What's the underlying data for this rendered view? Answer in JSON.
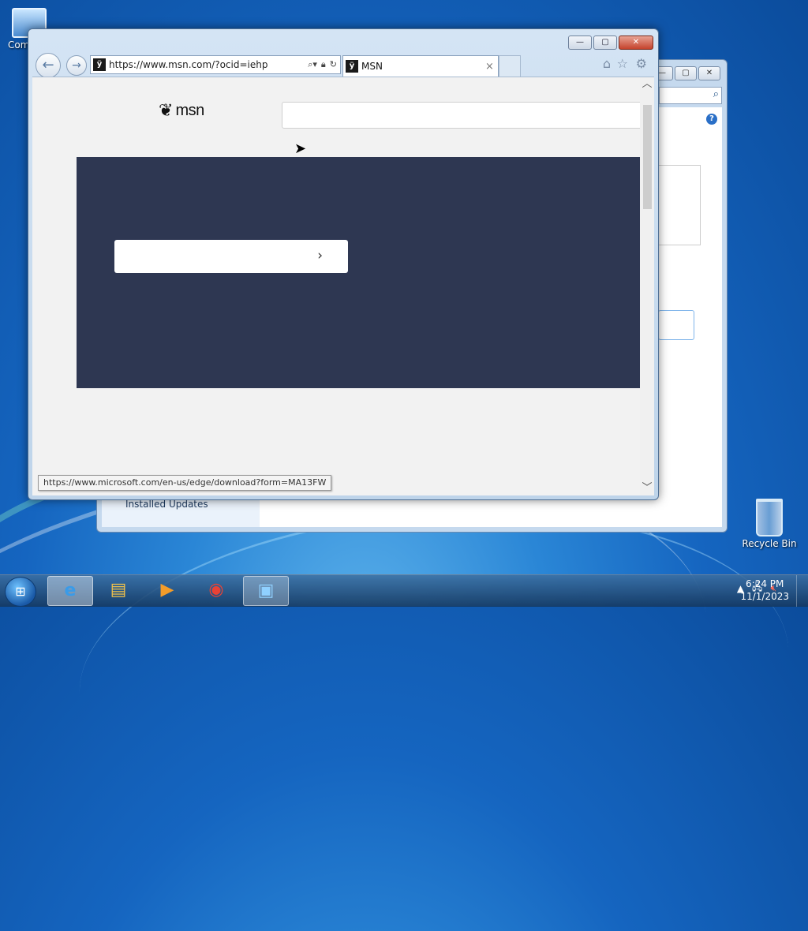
{
  "desktop": {
    "icons": [
      {
        "label": "Com"
      },
      {
        "label": "Recycle Bin"
      }
    ]
  },
  "back_window": {
    "buttons": [
      "—",
      "▢",
      "✕"
    ],
    "installed_updates": "Installed Updates",
    "help": "?"
  },
  "ie": {
    "window_buttons": {
      "minimize": "—",
      "maximize": "▢",
      "close": "✕"
    },
    "address": {
      "protocol": "https://",
      "url": "https://www.msn.com/?ocid=iehp"
    },
    "tab": {
      "title": "MSN",
      "close": "×"
    },
    "toolbar_icons": [
      "home-icon",
      "star-icon",
      "gear-icon"
    ],
    "page": {
      "logo_text": "msn",
      "search_placeholder": "",
      "banner_button_chevron": "›"
    },
    "status_url": "https://www.microsoft.com/en-us/edge/download?form=MA13FW"
  },
  "taskbar": {
    "items": [
      "internet-explorer-icon",
      "file-explorer-icon",
      "media-player-icon",
      "chrome-icon",
      "control-panel-icon"
    ],
    "active_item": "control-panel-icon",
    "time": "6:24 PM",
    "date": "11/1/2023"
  }
}
